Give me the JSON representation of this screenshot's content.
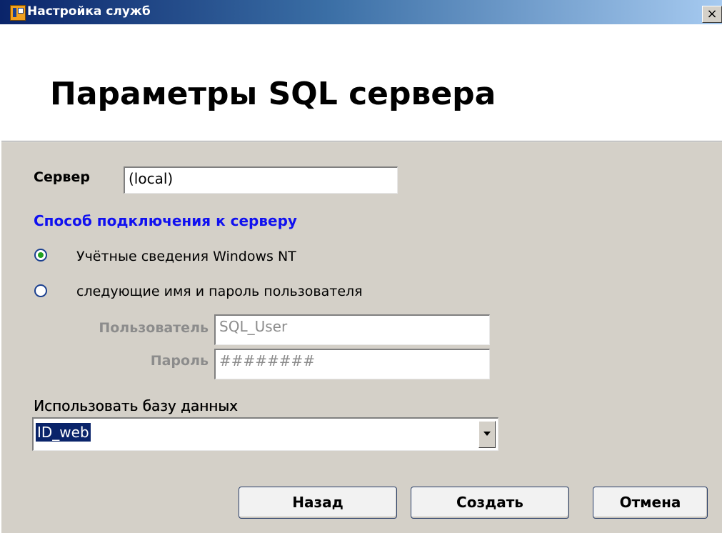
{
  "window": {
    "title": "Настройка служб",
    "close_label": "×"
  },
  "header": {
    "title": "Параметры SQL сервера"
  },
  "server": {
    "label": "Сервер",
    "value": "(local)"
  },
  "connection": {
    "section_title": "Способ подключения к серверу",
    "options": [
      {
        "label": "Учётные сведения Windows NT",
        "selected": true
      },
      {
        "label": "следующие имя и пароль пользователя",
        "selected": false
      }
    ],
    "user_label": "Пользователь",
    "user_value": "SQL_User",
    "password_label": "Пароль",
    "password_value": "########"
  },
  "database": {
    "label": "Использовать базу данных",
    "selected": "ID_web"
  },
  "buttons": {
    "back": "Назад",
    "create": "Создать",
    "cancel": "Отмена"
  },
  "colors": {
    "section_title": "#1010f0",
    "radio_checked": "#21a121",
    "selection": "#0a246a",
    "disabled_text": "#8c8c8c"
  }
}
